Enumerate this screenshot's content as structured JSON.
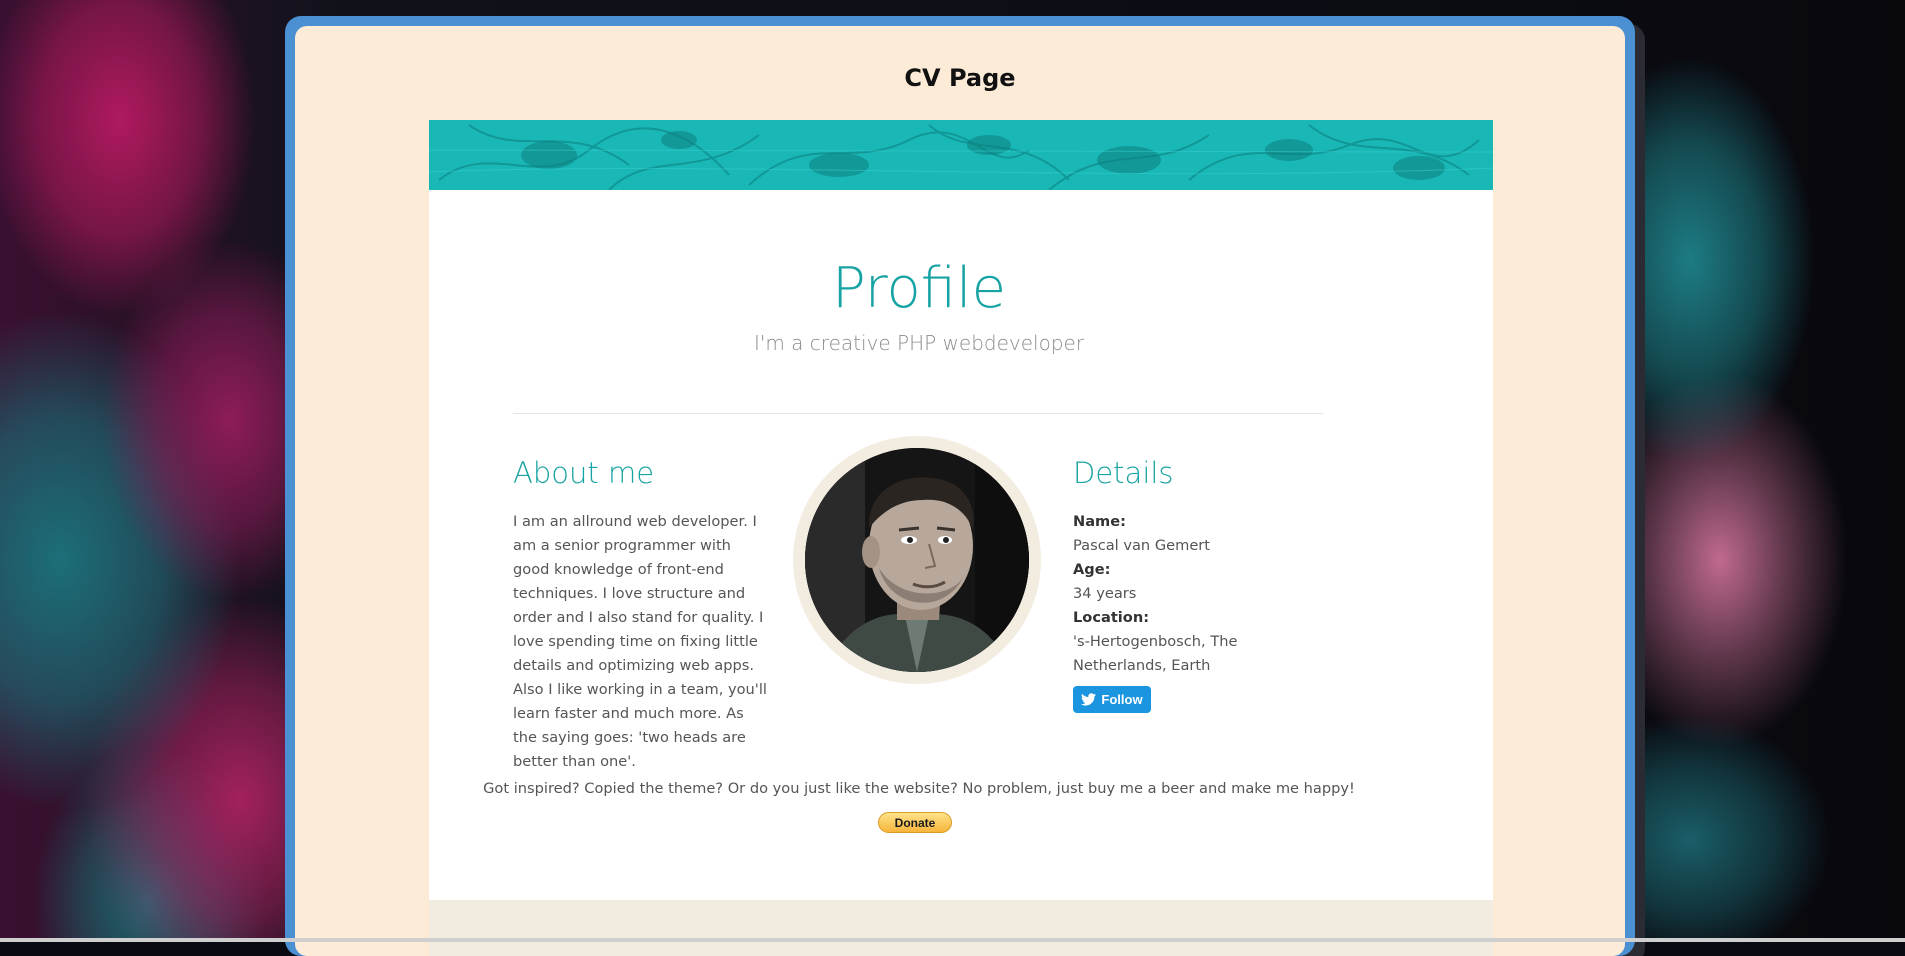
{
  "page": {
    "title": "CV Page"
  },
  "profile": {
    "heading": "Profile",
    "tagline": "I'm a creative PHP webdeveloper"
  },
  "about": {
    "heading": "About me",
    "text": "I am an allround web developer. I am a senior programmer with good knowledge of front-end techniques. I love structure and order and I also stand for quality. I love spending time on fixing little details and optimizing web apps. Also I like working in a team, you'll learn faster and much more. As the saying goes: 'two heads are better than one'."
  },
  "details": {
    "heading": "Details",
    "name_label": "Name:",
    "name_value": "Pascal van Gemert",
    "age_label": "Age:",
    "age_value": "34 years",
    "location_label": "Location:",
    "location_value": "'s-Hertogenbosch, The Netherlands, Earth",
    "follow_label": "Follow"
  },
  "support": {
    "message": "Got inspired? Copied the theme? Or do you just like the website? No problem, just buy me a beer and make me happy!",
    "donate_label": "Donate"
  },
  "colors": {
    "accent": "#17a3a3",
    "window_border": "#4a90d2",
    "page_background": "#fbebd7",
    "twitter_blue": "#1b95e0"
  },
  "icons": {
    "follow_button_icon": "twitter-bird-icon"
  }
}
